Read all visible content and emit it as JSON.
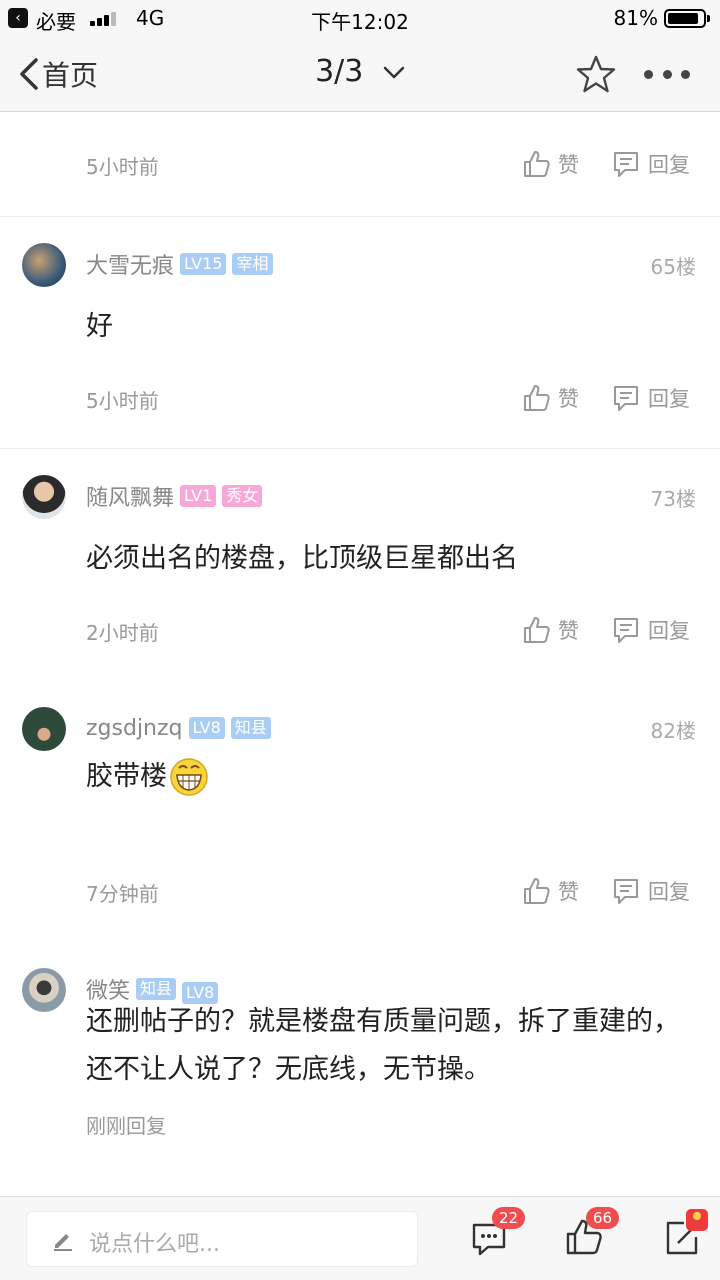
{
  "status_bar": {
    "app_name": "必要",
    "network": "4G",
    "time": "下午12:02",
    "battery": "81%"
  },
  "nav": {
    "back_label": "首页",
    "title": "3/3"
  },
  "top_fragment": {
    "time": "5小时前",
    "like_label": "赞",
    "reply_label": "回复"
  },
  "comments": [
    {
      "username": "大雪无痕",
      "badges": [
        {
          "text": "LV15",
          "color": "#a9cdf5"
        },
        {
          "text": "宰相",
          "color": "#a9cdf5"
        }
      ],
      "floor": "65楼",
      "text": "好",
      "time": "5小时前",
      "like_label": "赞",
      "reply_label": "回复"
    },
    {
      "username": "随风飘舞",
      "badges": [
        {
          "text": "LV1",
          "color": "#f6a9d8"
        },
        {
          "text": "秀女",
          "color": "#f6a9d8"
        }
      ],
      "floor": "73楼",
      "text": "必须出名的楼盘，比顶级巨星都出名",
      "time": "2小时前",
      "like_label": "赞",
      "reply_label": "回复"
    },
    {
      "username": "zgsdjnzq",
      "badges": [
        {
          "text": "LV8",
          "color": "#a9cdf5"
        },
        {
          "text": "知县",
          "color": "#a9cdf5"
        }
      ],
      "floor": "82楼",
      "text": "胶带楼",
      "emoji": "grinning-face",
      "time": "7分钟前",
      "like_label": "赞",
      "reply_label": "回复"
    },
    {
      "username": "微笑",
      "badges": [
        {
          "text": "知县",
          "color": "#a9cdf5"
        },
        {
          "text": "LV8",
          "color": "#a9cdf5"
        }
      ],
      "text": "还删帖子的？就是楼盘有质量问题，拆了重建的，还不让人说了？无底线，无节操。",
      "time": "刚刚回复"
    }
  ],
  "bottom_bar": {
    "input_placeholder": "说点什么吧...",
    "comment_count": "22",
    "like_count": "66"
  },
  "icons": [
    "back-chevron-icon",
    "star-icon",
    "more-icon",
    "thumbs-up-icon",
    "reply-bubble-icon",
    "pencil-icon",
    "comment-icon",
    "share-icon"
  ]
}
